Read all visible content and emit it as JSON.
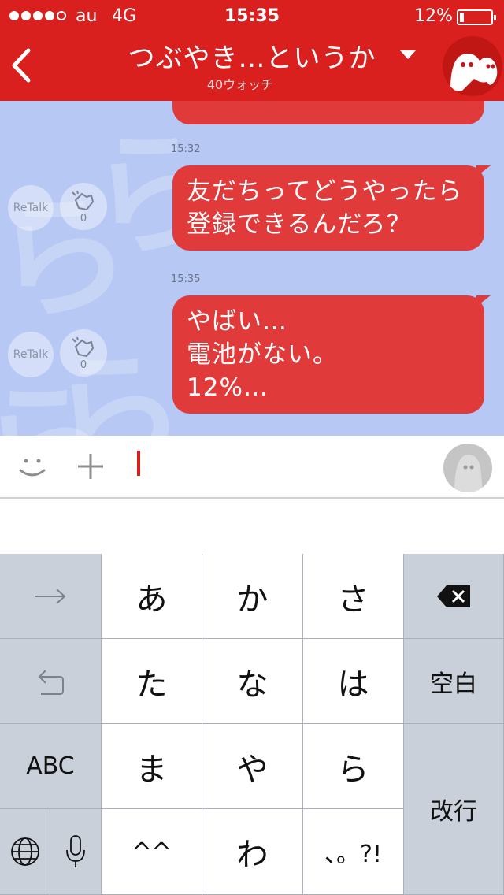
{
  "status": {
    "carrier": "au",
    "network": "4G",
    "time": "15:35",
    "battery": "12%",
    "battery_level": 0.12
  },
  "header": {
    "title": "つぶやき…というか",
    "subtitle": "40ウォッチ"
  },
  "chat": {
    "messages": [
      {
        "time": "15:32",
        "lines": [
          "友だちってどうやったら",
          "登録できるんだろ？"
        ],
        "retalk": "ReTalk",
        "claps": "0"
      },
      {
        "time": "15:35",
        "lines": [
          "やばい…",
          "電池がない。",
          "12%…"
        ],
        "retalk": "ReTalk",
        "claps": "0"
      }
    ]
  },
  "input": {
    "value": ""
  },
  "keyboard": {
    "row1": [
      "→",
      "あ",
      "か",
      "さ",
      "⌫"
    ],
    "row2": [
      "↺",
      "た",
      "な",
      "は",
      "空白"
    ],
    "row3": [
      "ABC",
      "ま",
      "や",
      "ら",
      "改行"
    ],
    "row4": [
      "globe",
      "mic",
      "^^",
      "わ",
      "、。?!"
    ]
  },
  "colors": {
    "brand": "#d9201f",
    "bubble": "#e03a3b",
    "chat_bg": "#b7c8f4"
  }
}
